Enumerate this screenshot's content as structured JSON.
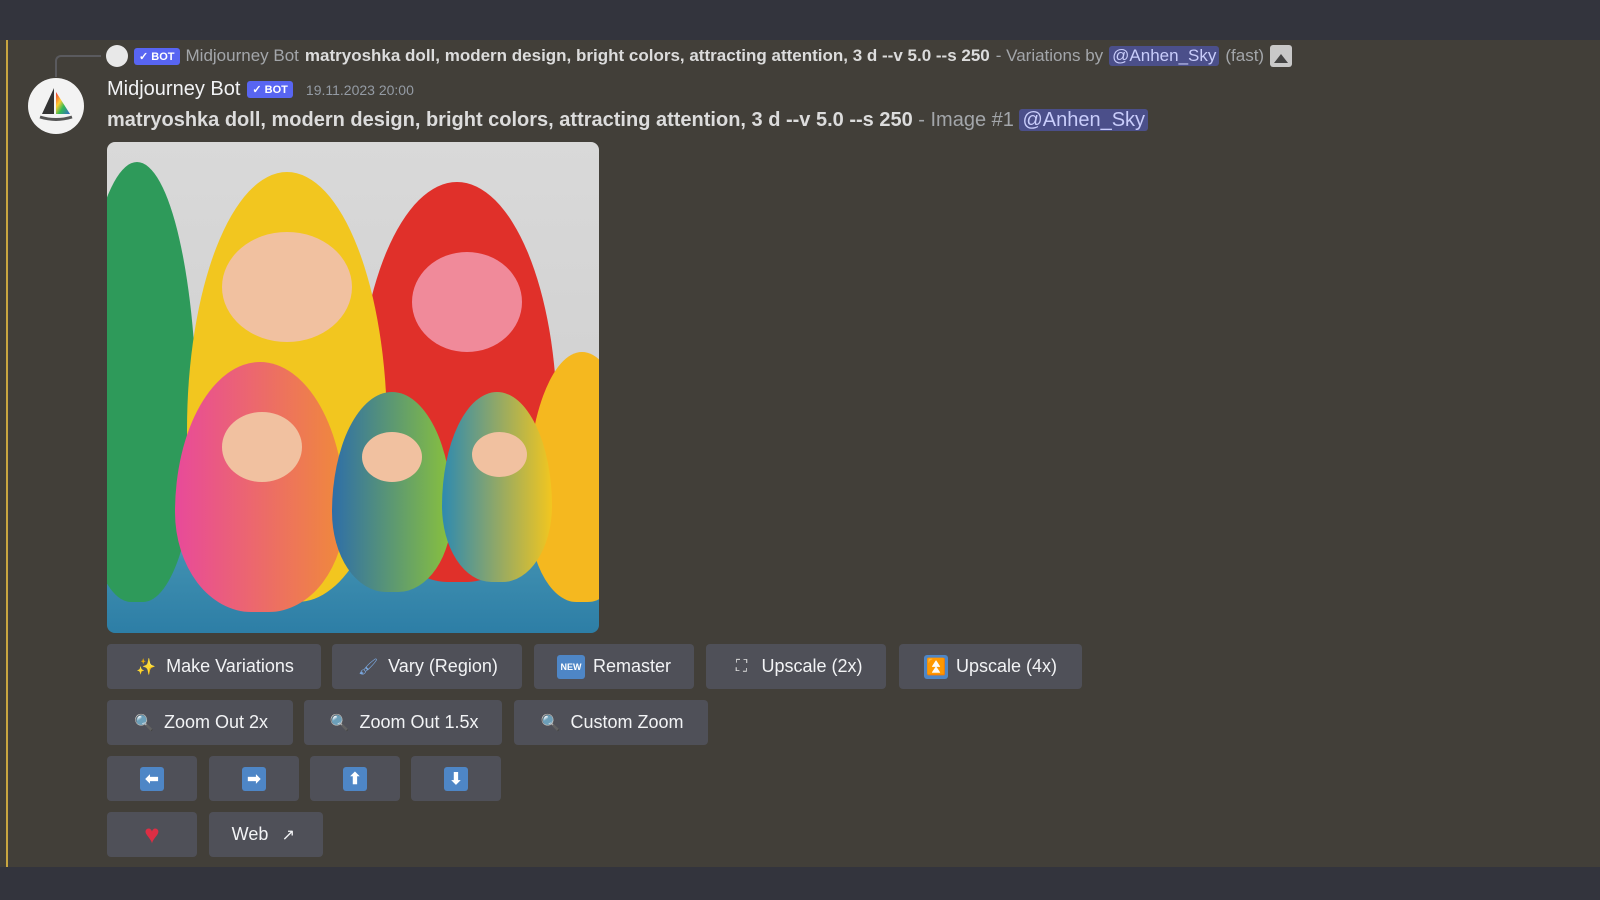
{
  "reply": {
    "bot_badge": "✓ BOT",
    "author": "Midjourney Bot",
    "prompt": "matryoshka doll, modern design, bright colors, attracting attention, 3 d --v 5.0 --s 250",
    "suffix": "- Variations by",
    "mention": "@Anhen_Sky",
    "speed": "(fast)"
  },
  "message": {
    "author": "Midjourney Bot",
    "bot_badge": "✓ BOT",
    "timestamp": "19.11.2023 20:00",
    "prompt": "matryoshka doll, modern design, bright colors, attracting attention, 3 d --v 5.0 --s 250",
    "suffix": "- Image #1",
    "mention": "@Anhen_Sky"
  },
  "buttons": {
    "make_variations": "Make Variations",
    "vary_region": "Vary (Region)",
    "new_badge": "NEW",
    "remaster": "Remaster",
    "upscale_2x": "Upscale (2x)",
    "upscale_4x": "Upscale (4x)",
    "zoom_out_2x": "Zoom Out 2x",
    "zoom_out_15x": "Zoom Out 1.5x",
    "custom_zoom": "Custom Zoom",
    "web": "Web"
  },
  "colors": {
    "accent": "#5865f2",
    "mention_bg": "#4b4f8a",
    "button_bg": "#4f5058",
    "heart": "#dd2e44"
  }
}
